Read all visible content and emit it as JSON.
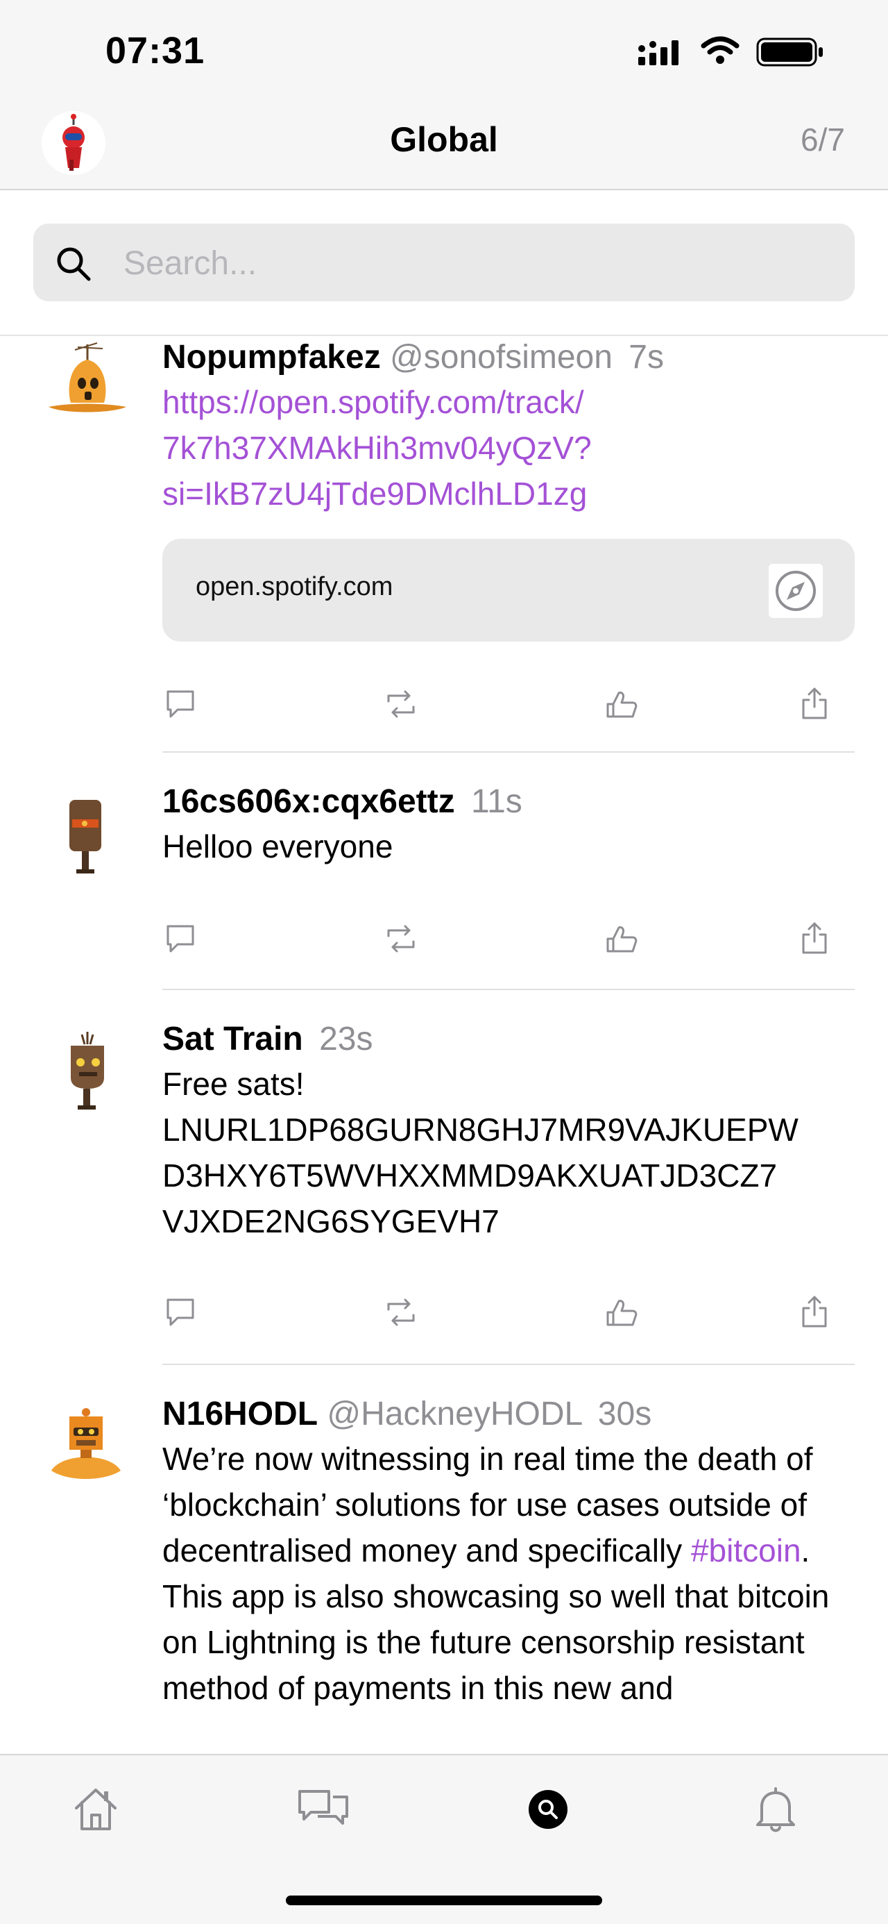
{
  "status_bar": {
    "time": "07:31"
  },
  "header": {
    "title": "Global",
    "page_counter": "6/7"
  },
  "search": {
    "placeholder": "Search..."
  },
  "colors": {
    "link": "#a451d6",
    "muted": "#8e8e93",
    "bar_bg": "#f6f6f6"
  },
  "posts": [
    {
      "display_name": "Nopumpfakez",
      "handle": "@sonofsimeon",
      "time": "7s",
      "text_lines": [
        "https://open.spotify.com/track/",
        "7k7h37XMAkHih3mv04yQzV?",
        "si=IkB7zU4jTde9DMclhLD1zg"
      ],
      "preview_domain": "open.spotify.com"
    },
    {
      "display_name": "16cs606x:cqx6ettz",
      "time": "11s",
      "text_lines": [
        "Helloo everyone"
      ]
    },
    {
      "display_name": "Sat Train",
      "time": "23s",
      "text_lines": [
        "Free sats!",
        "LNURL1DP68GURN8GHJ7MR9VAJKUEPW",
        "D3HXY6T5WVHXXMMD9AKXUATJD3CZ7",
        "VJXDE2NG6SYGEVH7"
      ]
    },
    {
      "display_name": "N16HODL",
      "handle": "@HackneyHODL",
      "time": "30s",
      "text": {
        "before": "We’re now witnessing in real time the death of ‘blockchain’ solutions for use cases outside of decentralised money and specifically ",
        "hashtag": "#bitcoin",
        "after": ". This app is also showcasing so well that bitcoin on Lightning is the future censorship resistant method of payments in this new and"
      }
    }
  ],
  "icons": {
    "reply": "reply-icon",
    "repost": "repost-icon",
    "like": "like-icon",
    "share": "share-icon",
    "open_link": "compass-icon",
    "tabs": [
      "home-icon",
      "messages-icon",
      "search-icon",
      "notifications-icon"
    ]
  }
}
